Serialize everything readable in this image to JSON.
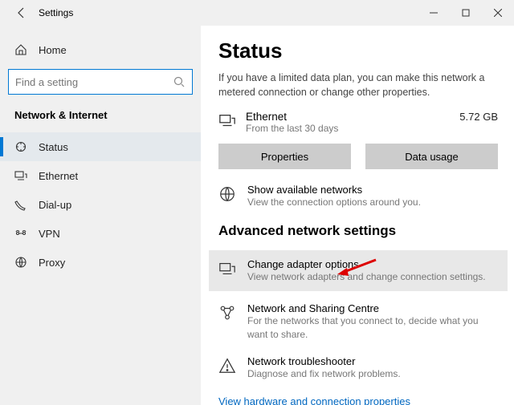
{
  "window": {
    "title": "Settings"
  },
  "sidebar": {
    "home": "Home",
    "search_placeholder": "Find a setting",
    "heading": "Network & Internet",
    "items": [
      {
        "label": "Status"
      },
      {
        "label": "Ethernet"
      },
      {
        "label": "Dial-up"
      },
      {
        "label": "VPN"
      },
      {
        "label": "Proxy"
      }
    ]
  },
  "main": {
    "title": "Status",
    "description": "If you have a limited data plan, you can make this network a metered connection or change other properties.",
    "network": {
      "name": "Ethernet",
      "sub": "From the last 30 days",
      "usage": "5.72 GB"
    },
    "buttons": {
      "properties": "Properties",
      "data_usage": "Data usage"
    },
    "show_networks": {
      "title": "Show available networks",
      "sub": "View the connection options around you."
    },
    "advanced_heading": "Advanced network settings",
    "adapter": {
      "title": "Change adapter options",
      "sub": "View network adapters and change connection settings."
    },
    "sharing": {
      "title": "Network and Sharing Centre",
      "sub": "For the networks that you connect to, decide what you want to share."
    },
    "troubleshoot": {
      "title": "Network troubleshooter",
      "sub": "Diagnose and fix network problems."
    },
    "link": "View hardware and connection properties"
  }
}
